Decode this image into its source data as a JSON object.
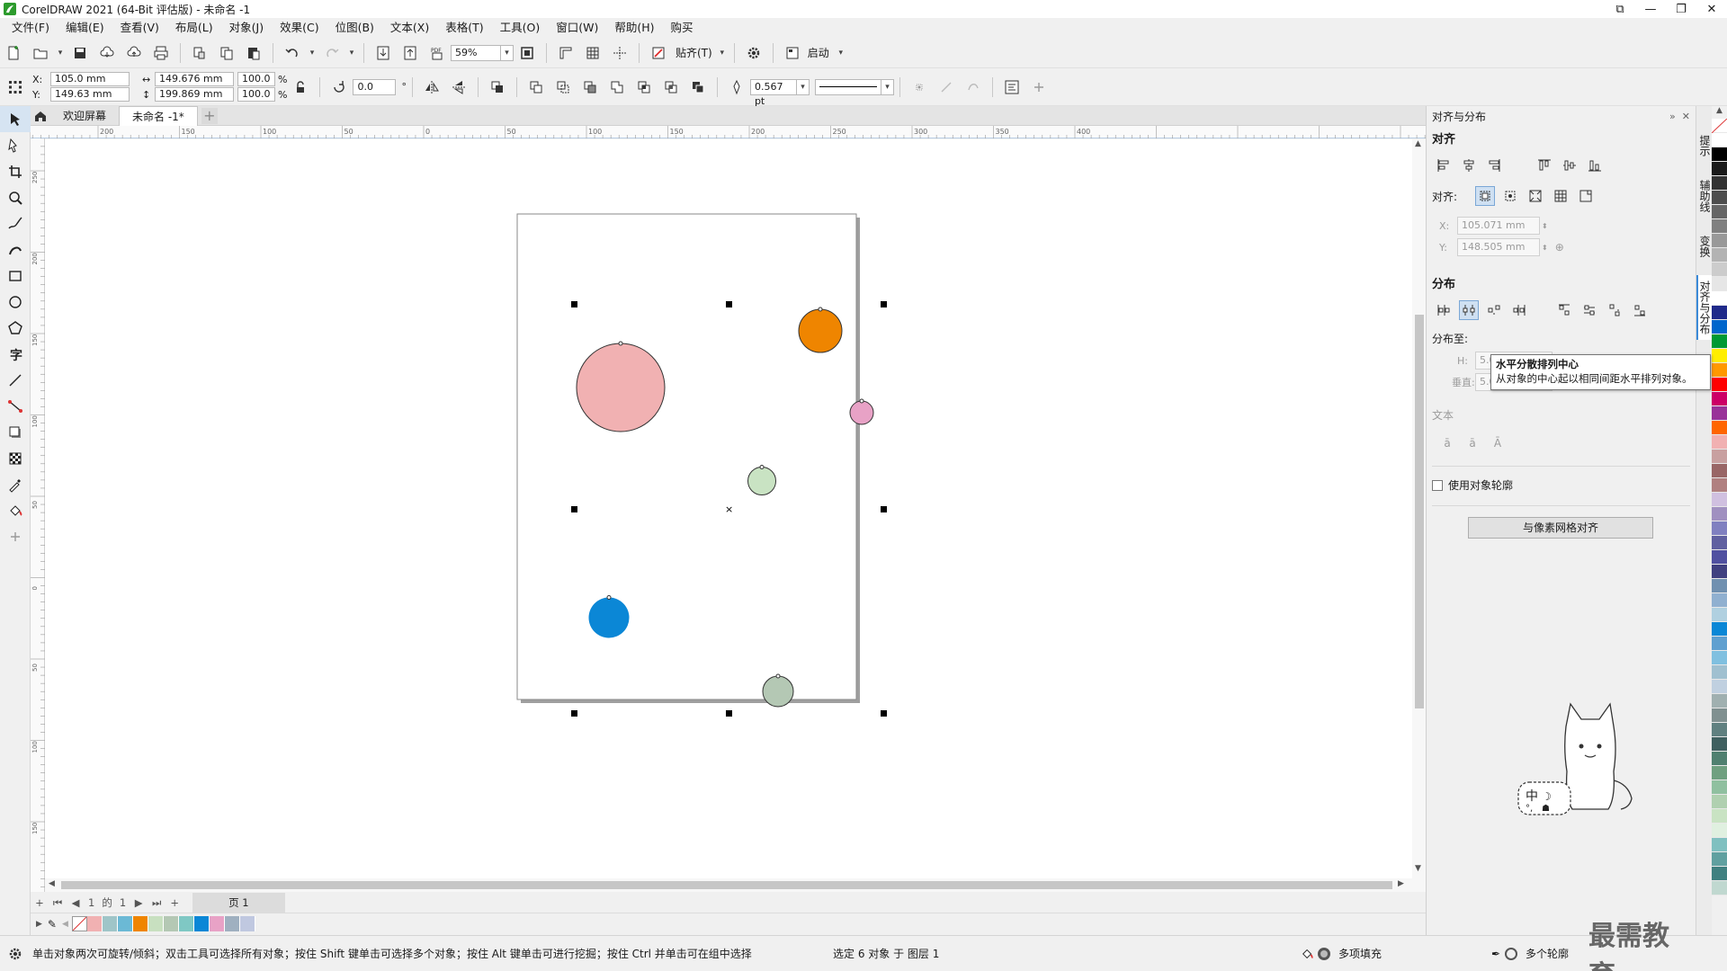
{
  "window": {
    "title": "CorelDRAW 2021 (64-Bit 评估版) - 未命名 -1"
  },
  "menu": [
    "文件(F)",
    "编辑(E)",
    "查看(V)",
    "布局(L)",
    "对象(J)",
    "效果(C)",
    "位图(B)",
    "文本(X)",
    "表格(T)",
    "工具(O)",
    "窗口(W)",
    "帮助(H)",
    "购买"
  ],
  "standard_toolbar": {
    "zoom": "59%",
    "snap_label": "贴齐(T)",
    "launch_label": "启动"
  },
  "property_bar": {
    "x_label": "X:",
    "x_value": "105.0 mm",
    "y_label": "Y:",
    "y_value": "149.63 mm",
    "width_value": "149.676 mm",
    "height_value": "199.869 mm",
    "scale_w": "100.0",
    "scale_h": "100.0",
    "percent": "%",
    "rotation": "0.0",
    "degree": "°",
    "outline_width": "0.567 pt"
  },
  "doc_tabs": {
    "welcome": "欢迎屏幕",
    "document": "未命名 -1*"
  },
  "ruler": {
    "labels": [
      "200",
      "150",
      "100",
      "50",
      "0",
      "50",
      "100",
      "150",
      "200",
      "250",
      "300",
      "350",
      "400"
    ],
    "vlabels": [
      "250",
      "200",
      "150",
      "100",
      "50",
      "0",
      "50",
      "100",
      "150"
    ]
  },
  "page_nav": {
    "current": "1",
    "of": "的",
    "total": "1",
    "page_tab": "页 1"
  },
  "status": {
    "hint": "单击对象两次可旋转/倾斜；双击工具可选择所有对象；按住 Shift 键单击可选择多个对象；按住 Alt 键单击可进行挖掘；按住 Ctrl 并单击可在组中选择",
    "selection": "选定 6 对象 于 图层 1",
    "fill_label": "多项填充",
    "outline_label": "多个轮廓"
  },
  "docker": {
    "title": "对齐与分布",
    "align_heading": "对齐",
    "align_to_label": "对齐:",
    "x_label": "X:",
    "x_value": "105.071 mm",
    "y_label": "Y:",
    "y_value": "148.505 mm",
    "distribute_heading": "分布",
    "distribute_to_label": "分布至:",
    "h_label": "H:",
    "h_value": "5.08 mm",
    "v_label": "垂直:",
    "v_value": "5.08 mm",
    "text_heading": "文本",
    "use_outline_label": "使用对象轮廓",
    "pixel_grid_button": "与像素网格对齐"
  },
  "tooltip": {
    "title": "水平分散排列中心",
    "body": "从对象的中心起以相同间距水平排列对象。"
  },
  "side_tabs": [
    "提示",
    "辅助线",
    "变换",
    "对齐与分布"
  ],
  "watermark": "最需教育",
  "ime_badge": "中",
  "circles": [
    {
      "name": "large-pink-circle",
      "fill": "#f1b1b2"
    },
    {
      "name": "orange-circle",
      "fill": "#ef8500"
    },
    {
      "name": "small-pink-circle",
      "fill": "#e8a2c6"
    },
    {
      "name": "light-green-circle",
      "fill": "#c9e3c3"
    },
    {
      "name": "blue-circle",
      "fill": "#0b87d6"
    },
    {
      "name": "gray-green-circle",
      "fill": "#b4c8b4"
    }
  ],
  "doc_palette_colors": [
    "#f1b1b2",
    "#9fc5c8",
    "#6bb9d5",
    "#ef8500",
    "#c8e0c0",
    "#b4c8b4",
    "#7fc8c4",
    "#0b87d6",
    "#e8a2c6",
    "#9fb0c0",
    "#c0c8e0"
  ],
  "palette_colors": [
    "#ffffff",
    "#000000",
    "#1a1a1a",
    "#333333",
    "#4d4d4d",
    "#666666",
    "#808080",
    "#999999",
    "#b3b3b3",
    "#cccccc",
    "#e6e6e6",
    "#ffffff",
    "#1f2a8a",
    "#0066cc",
    "#009933",
    "#ffee00",
    "#ff9900",
    "#ff0000",
    "#cc0066",
    "#993399",
    "#ff6600",
    "#f1b1b2",
    "#c8a0a0",
    "#996666",
    "#b08080",
    "#d0c0e0",
    "#a090c0",
    "#8080c0",
    "#6060a0",
    "#5050a0",
    "#404080",
    "#7090b0",
    "#90b0d0",
    "#b0d0e0",
    "#0b87d6",
    "#60a0d0",
    "#80c0e0",
    "#a0c0d0",
    "#c0d0e0",
    "#a0b0b0",
    "#809090",
    "#608080",
    "#406060",
    "#508070",
    "#70a080",
    "#90c0a0",
    "#b0d0b0",
    "#c9e3c3",
    "#e0f0e0",
    "#80c0c0",
    "#60a0a0",
    "#408080",
    "#c0d8d0"
  ]
}
